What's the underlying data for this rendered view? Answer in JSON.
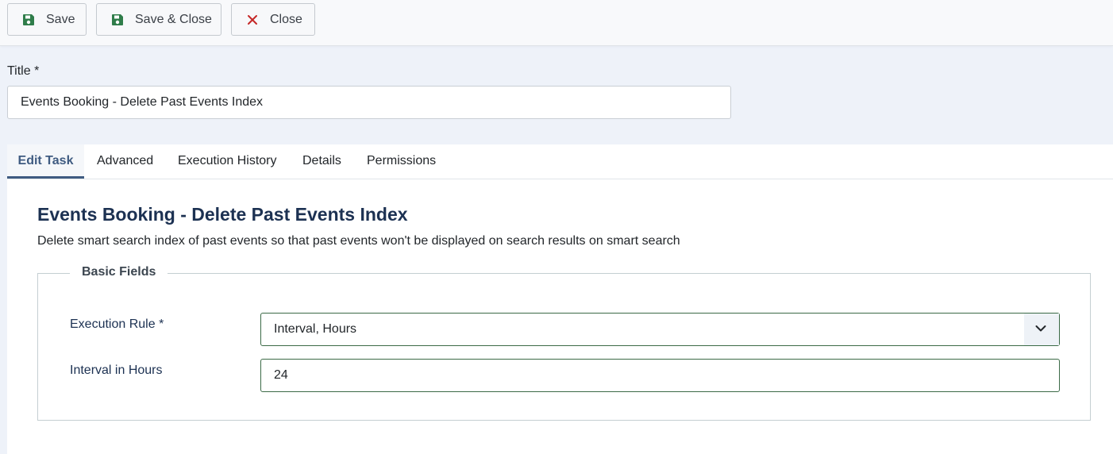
{
  "toolbar": {
    "save_label": "Save",
    "save_close_label": "Save & Close",
    "close_label": "Close"
  },
  "title_field": {
    "label": "Title *",
    "value": "Events Booking - Delete Past Events Index"
  },
  "tabs": [
    {
      "label": "Edit Task",
      "active": true
    },
    {
      "label": "Advanced",
      "active": false
    },
    {
      "label": "Execution History",
      "active": false
    },
    {
      "label": "Details",
      "active": false
    },
    {
      "label": "Permissions",
      "active": false
    }
  ],
  "task": {
    "title": "Events Booking - Delete Past Events Index",
    "description": "Delete smart search index of past events so that past events won't be displayed on search results on smart search"
  },
  "basic_fields": {
    "legend": "Basic Fields",
    "execution_rule_label": "Execution Rule *",
    "execution_rule_value": "Interval, Hours",
    "interval_label": "Interval in Hours",
    "interval_value": "24"
  },
  "icons": {
    "save": "floppy-disk-icon",
    "save_close": "floppy-disk-icon",
    "close": "x-icon",
    "dropdown": "chevron-down-icon"
  },
  "colors": {
    "save_icon": "#2f7d4a",
    "close_icon": "#c52827",
    "active_tab": "#3f5b81",
    "heading": "#1c3152",
    "input_border_valid": "#3b6a46"
  }
}
